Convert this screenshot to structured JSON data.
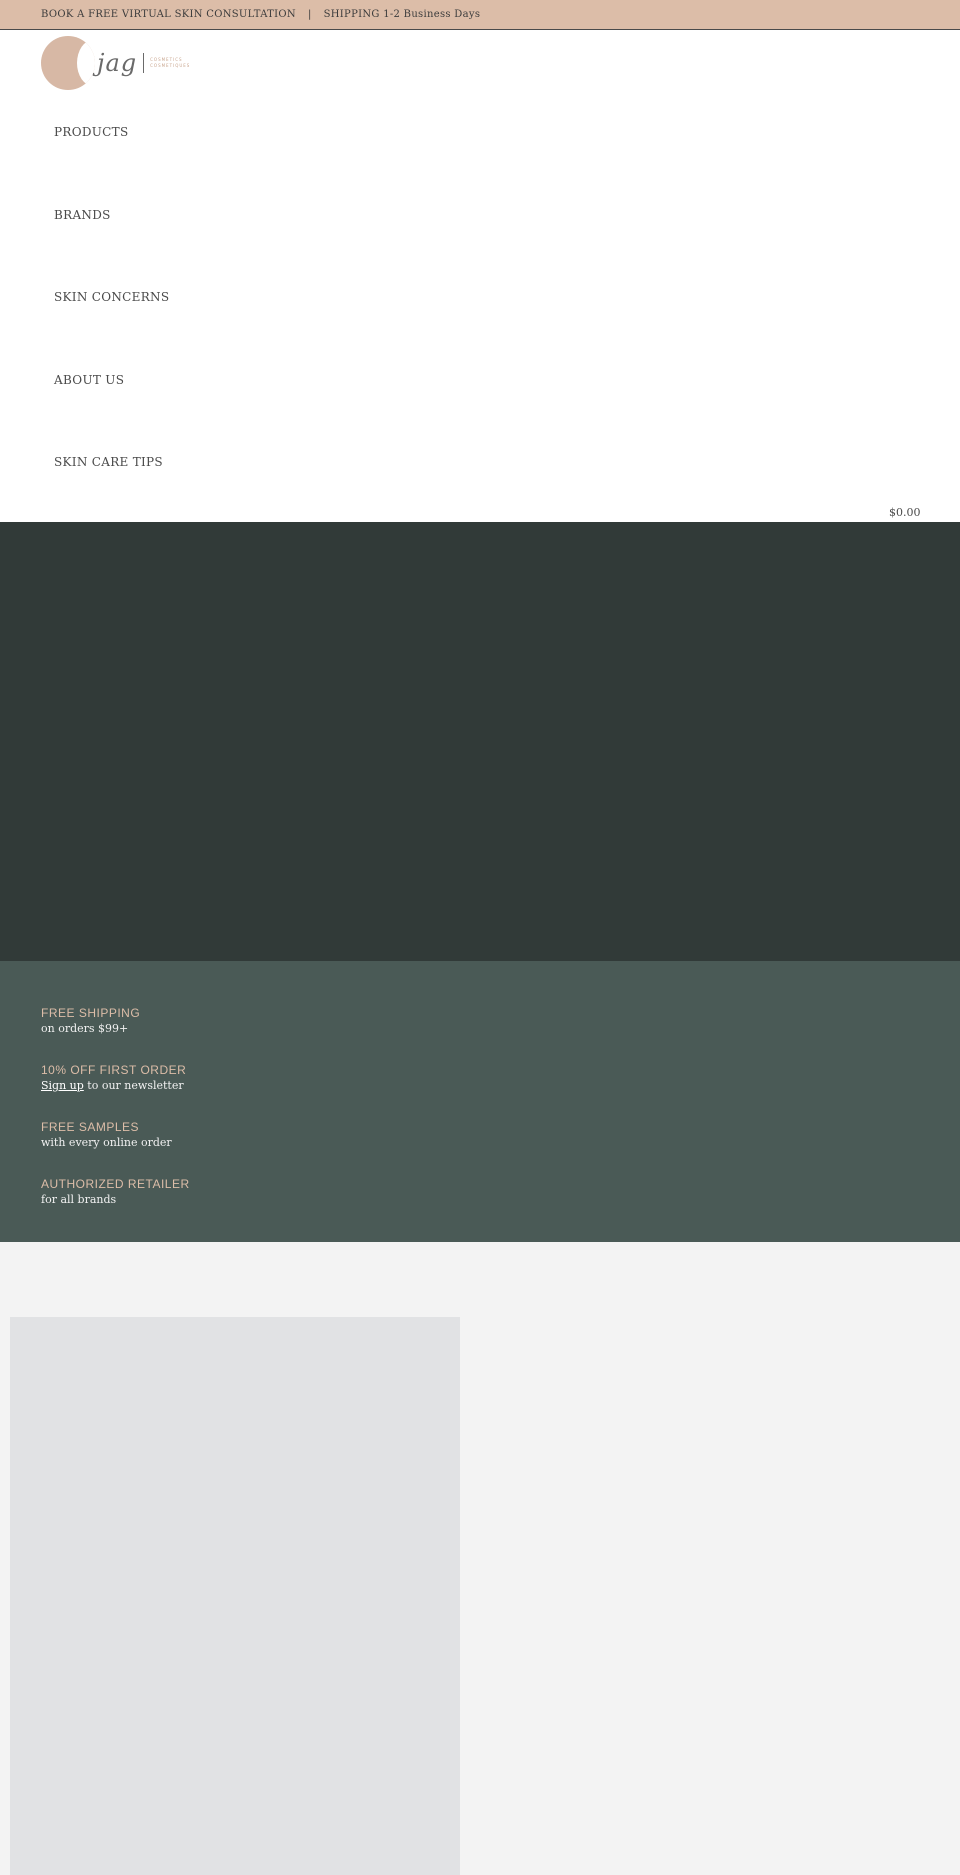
{
  "announcement": {
    "consultation": "BOOK A FREE VIRTUAL SKIN CONSULTATION",
    "separator": "|",
    "shipping_label": "SHIPPING",
    "shipping_time": "1-2 Business Days"
  },
  "logo": {
    "wordmark": "jag",
    "subline_1": "COSMETICS",
    "subline_2": "COSMETIQUES"
  },
  "nav": {
    "items": [
      {
        "label": "PRODUCTS"
      },
      {
        "label": "BRANDS"
      },
      {
        "label": "SKIN CONCERNS"
      },
      {
        "label": "ABOUT US"
      },
      {
        "label": "SKIN CARE TIPS"
      }
    ]
  },
  "cart": {
    "total": "$0.00"
  },
  "perks": [
    {
      "title": "FREE SHIPPING",
      "subtitle": "on orders $99+"
    },
    {
      "title": "10% OFF FIRST ORDER",
      "link": "Sign up",
      "subtitle": " to our newsletter"
    },
    {
      "title": "FREE SAMPLES",
      "subtitle": "with every online order"
    },
    {
      "title": "AUTHORIZED RETAILER",
      "subtitle": "for all brands"
    }
  ],
  "colors": {
    "announcement_bg": "#dcbda8",
    "hero_bg": "#313a38",
    "perks_bg": "#4a5a56",
    "perk_title": "#dcbda8",
    "card_placeholder": "#e1e2e4"
  }
}
